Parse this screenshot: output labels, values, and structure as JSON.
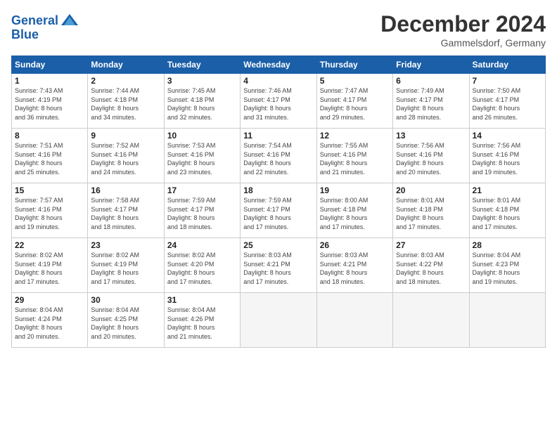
{
  "header": {
    "logo_line1": "General",
    "logo_line2": "Blue",
    "title": "December 2024",
    "location": "Gammelsdorf, Germany"
  },
  "days_of_week": [
    "Sunday",
    "Monday",
    "Tuesday",
    "Wednesday",
    "Thursday",
    "Friday",
    "Saturday"
  ],
  "weeks": [
    [
      {
        "day": 1,
        "info": "Sunrise: 7:43 AM\nSunset: 4:19 PM\nDaylight: 8 hours\nand 36 minutes."
      },
      {
        "day": 2,
        "info": "Sunrise: 7:44 AM\nSunset: 4:18 PM\nDaylight: 8 hours\nand 34 minutes."
      },
      {
        "day": 3,
        "info": "Sunrise: 7:45 AM\nSunset: 4:18 PM\nDaylight: 8 hours\nand 32 minutes."
      },
      {
        "day": 4,
        "info": "Sunrise: 7:46 AM\nSunset: 4:17 PM\nDaylight: 8 hours\nand 31 minutes."
      },
      {
        "day": 5,
        "info": "Sunrise: 7:47 AM\nSunset: 4:17 PM\nDaylight: 8 hours\nand 29 minutes."
      },
      {
        "day": 6,
        "info": "Sunrise: 7:49 AM\nSunset: 4:17 PM\nDaylight: 8 hours\nand 28 minutes."
      },
      {
        "day": 7,
        "info": "Sunrise: 7:50 AM\nSunset: 4:17 PM\nDaylight: 8 hours\nand 26 minutes."
      }
    ],
    [
      {
        "day": 8,
        "info": "Sunrise: 7:51 AM\nSunset: 4:16 PM\nDaylight: 8 hours\nand 25 minutes."
      },
      {
        "day": 9,
        "info": "Sunrise: 7:52 AM\nSunset: 4:16 PM\nDaylight: 8 hours\nand 24 minutes."
      },
      {
        "day": 10,
        "info": "Sunrise: 7:53 AM\nSunset: 4:16 PM\nDaylight: 8 hours\nand 23 minutes."
      },
      {
        "day": 11,
        "info": "Sunrise: 7:54 AM\nSunset: 4:16 PM\nDaylight: 8 hours\nand 22 minutes."
      },
      {
        "day": 12,
        "info": "Sunrise: 7:55 AM\nSunset: 4:16 PM\nDaylight: 8 hours\nand 21 minutes."
      },
      {
        "day": 13,
        "info": "Sunrise: 7:56 AM\nSunset: 4:16 PM\nDaylight: 8 hours\nand 20 minutes."
      },
      {
        "day": 14,
        "info": "Sunrise: 7:56 AM\nSunset: 4:16 PM\nDaylight: 8 hours\nand 19 minutes."
      }
    ],
    [
      {
        "day": 15,
        "info": "Sunrise: 7:57 AM\nSunset: 4:16 PM\nDaylight: 8 hours\nand 19 minutes."
      },
      {
        "day": 16,
        "info": "Sunrise: 7:58 AM\nSunset: 4:17 PM\nDaylight: 8 hours\nand 18 minutes."
      },
      {
        "day": 17,
        "info": "Sunrise: 7:59 AM\nSunset: 4:17 PM\nDaylight: 8 hours\nand 18 minutes."
      },
      {
        "day": 18,
        "info": "Sunrise: 7:59 AM\nSunset: 4:17 PM\nDaylight: 8 hours\nand 17 minutes."
      },
      {
        "day": 19,
        "info": "Sunrise: 8:00 AM\nSunset: 4:18 PM\nDaylight: 8 hours\nand 17 minutes."
      },
      {
        "day": 20,
        "info": "Sunrise: 8:01 AM\nSunset: 4:18 PM\nDaylight: 8 hours\nand 17 minutes."
      },
      {
        "day": 21,
        "info": "Sunrise: 8:01 AM\nSunset: 4:18 PM\nDaylight: 8 hours\nand 17 minutes."
      }
    ],
    [
      {
        "day": 22,
        "info": "Sunrise: 8:02 AM\nSunset: 4:19 PM\nDaylight: 8 hours\nand 17 minutes."
      },
      {
        "day": 23,
        "info": "Sunrise: 8:02 AM\nSunset: 4:19 PM\nDaylight: 8 hours\nand 17 minutes."
      },
      {
        "day": 24,
        "info": "Sunrise: 8:02 AM\nSunset: 4:20 PM\nDaylight: 8 hours\nand 17 minutes."
      },
      {
        "day": 25,
        "info": "Sunrise: 8:03 AM\nSunset: 4:21 PM\nDaylight: 8 hours\nand 17 minutes."
      },
      {
        "day": 26,
        "info": "Sunrise: 8:03 AM\nSunset: 4:21 PM\nDaylight: 8 hours\nand 18 minutes."
      },
      {
        "day": 27,
        "info": "Sunrise: 8:03 AM\nSunset: 4:22 PM\nDaylight: 8 hours\nand 18 minutes."
      },
      {
        "day": 28,
        "info": "Sunrise: 8:04 AM\nSunset: 4:23 PM\nDaylight: 8 hours\nand 19 minutes."
      }
    ],
    [
      {
        "day": 29,
        "info": "Sunrise: 8:04 AM\nSunset: 4:24 PM\nDaylight: 8 hours\nand 20 minutes."
      },
      {
        "day": 30,
        "info": "Sunrise: 8:04 AM\nSunset: 4:25 PM\nDaylight: 8 hours\nand 20 minutes."
      },
      {
        "day": 31,
        "info": "Sunrise: 8:04 AM\nSunset: 4:26 PM\nDaylight: 8 hours\nand 21 minutes."
      },
      null,
      null,
      null,
      null
    ]
  ]
}
